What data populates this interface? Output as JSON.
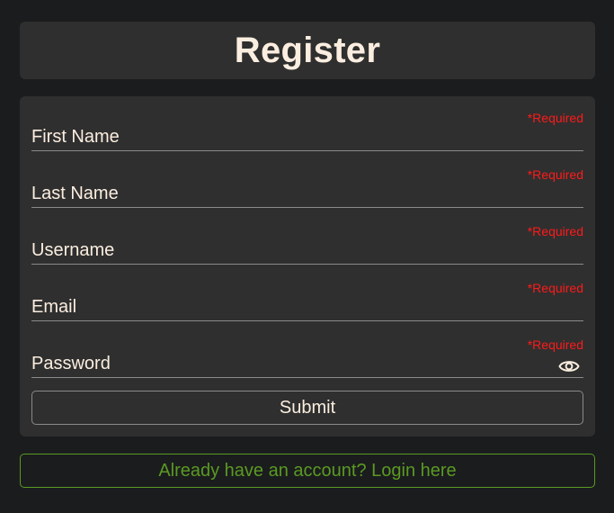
{
  "header": {
    "title": "Register"
  },
  "form": {
    "required_label": "*Required",
    "fields": [
      {
        "placeholder": "First Name",
        "value": ""
      },
      {
        "placeholder": "Last Name",
        "value": ""
      },
      {
        "placeholder": "Username",
        "value": ""
      },
      {
        "placeholder": "Email",
        "value": ""
      },
      {
        "placeholder": "Password",
        "value": "",
        "toggle_icon": "eye-icon"
      }
    ],
    "submit_label": "Submit"
  },
  "footer": {
    "login_link": "Already have an account? Login here"
  },
  "colors": {
    "background": "#1b1c1e",
    "card": "#2f2f2f",
    "text": "#fbeee0",
    "required": "#ff1a1a",
    "link": "#5a9a22"
  }
}
